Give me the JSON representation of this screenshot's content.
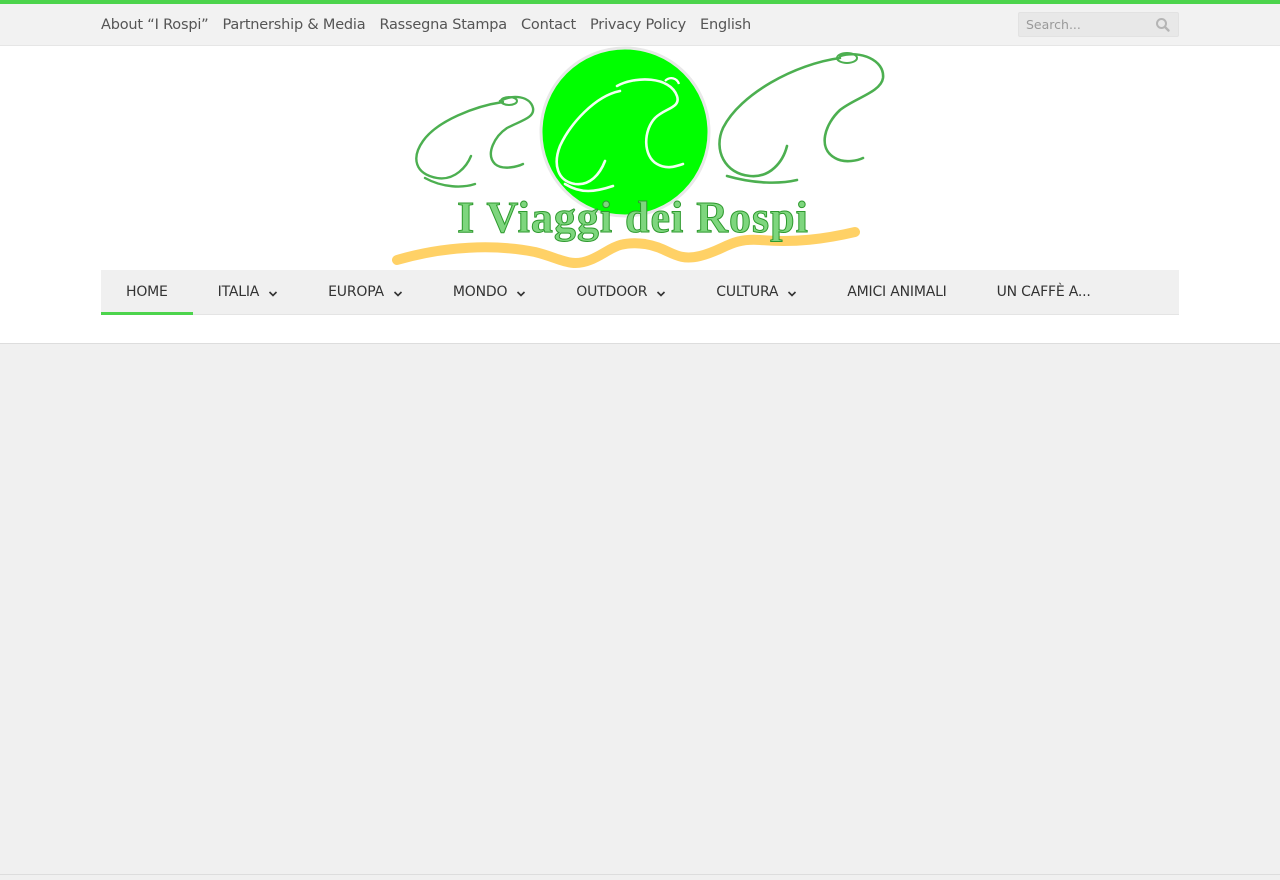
{
  "brand": {
    "accent_color": "#4cd44c",
    "logo_text": "I Viaggi dei Rospi",
    "logo_circle_color": "#00ff00",
    "logo_ribbon_color": "#ffcc55"
  },
  "topbar": {
    "links": [
      "About “I Rospi”",
      "Partnership & Media",
      "Rassegna Stampa",
      "Contact",
      "Privacy Policy",
      "English"
    ],
    "search": {
      "placeholder": "Search...",
      "icon": "search-icon"
    }
  },
  "main_nav": {
    "items": [
      {
        "label": "HOME",
        "active": true,
        "has_dropdown": false
      },
      {
        "label": "ITALIA",
        "active": false,
        "has_dropdown": true
      },
      {
        "label": "EUROPA",
        "active": false,
        "has_dropdown": true
      },
      {
        "label": "MONDO",
        "active": false,
        "has_dropdown": true
      },
      {
        "label": "OUTDOOR",
        "active": false,
        "has_dropdown": true
      },
      {
        "label": "CULTURA",
        "active": false,
        "has_dropdown": true
      },
      {
        "label": "AMICI ANIMALI",
        "active": false,
        "has_dropdown": false
      },
      {
        "label": "UN CAFFÈ A...",
        "active": false,
        "has_dropdown": false
      }
    ]
  }
}
